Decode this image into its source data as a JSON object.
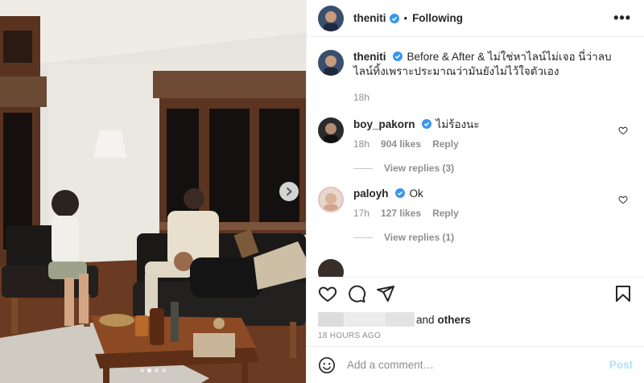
{
  "header": {
    "username": "theniti",
    "separator": "•",
    "follow_status": "Following",
    "more_label": "•••"
  },
  "caption": {
    "username": "theniti",
    "text": "Before & After & ไม่ใช่หาไลน์ไม่เจอ นี่ว่าลบไลน์ทิ้งเพราะประมาณว่ามันยังไม่ไว้ใจตัวเอง",
    "time": "18h"
  },
  "comments": [
    {
      "username": "boy_pakorn",
      "text": "ไม่ร้องนะ",
      "time": "18h",
      "likes": "904 likes",
      "reply": "Reply",
      "view_replies": "View replies (3)"
    },
    {
      "username": "paloyh",
      "text": "Ok",
      "time": "17h",
      "likes": "127 likes",
      "reply": "Reply",
      "view_replies": "View replies (1)"
    }
  ],
  "likes": {
    "and": "and",
    "others": "others"
  },
  "timestamp": "18 HOURS AGO",
  "add_comment": {
    "placeholder": "Add a comment…",
    "post_label": "Post"
  },
  "carousel": {
    "slides": 4,
    "active_index": 1
  },
  "icons": {
    "verified": "verified-badge-icon",
    "heart": "heart-icon",
    "comment": "comment-icon",
    "share": "share-icon",
    "save": "bookmark-icon",
    "emoji": "emoji-icon",
    "next": "chevron-right-icon"
  },
  "colors": {
    "verified": "#3897f0",
    "post_button_disabled": "#b2dffc",
    "secondary_text": "#8e8e8e"
  }
}
